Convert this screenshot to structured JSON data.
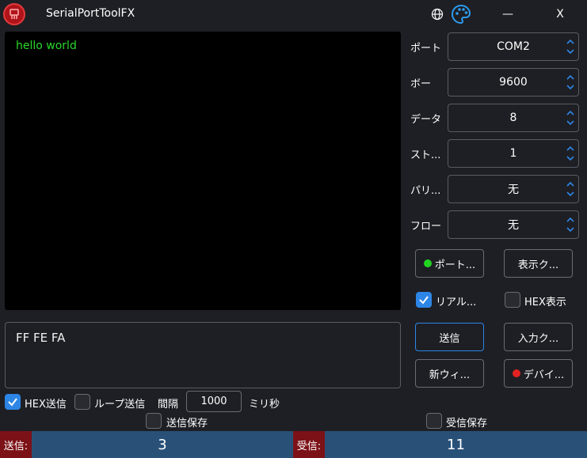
{
  "window": {
    "title": "SerialPortToolFX",
    "minimize_label": "—",
    "close_label": "X"
  },
  "receive": {
    "text": "hello world"
  },
  "send": {
    "text": "FF FE FA"
  },
  "settings": [
    {
      "label": "ポート",
      "value": "COM2"
    },
    {
      "label": "ボー",
      "value": "9600"
    },
    {
      "label": "データ",
      "value": "8"
    },
    {
      "label": "スト...",
      "value": "1"
    },
    {
      "label": "パリ...",
      "value": "无"
    },
    {
      "label": "フロー",
      "value": "无"
    }
  ],
  "buttons": {
    "port": "ポート...",
    "display_clear": "表示ク...",
    "send": "送信",
    "input_clear": "入力ク...",
    "new_window": "新ウィ...",
    "device": "デバイ..."
  },
  "checkboxes": {
    "realtime": {
      "label": "リアル...",
      "checked": true
    },
    "hex_display": {
      "label": "HEX表示",
      "checked": false
    },
    "hex_send": {
      "label": "HEX送信",
      "checked": true
    },
    "loop_send": {
      "label": "ループ送信",
      "checked": false
    },
    "send_save": {
      "label": "送信保存",
      "checked": false
    },
    "recv_save": {
      "label": "受信保存",
      "checked": false
    }
  },
  "interval": {
    "label": "間隔",
    "value": "1000",
    "unit": "ミリ秒"
  },
  "status": {
    "send_label": "送信:",
    "send_count": "3",
    "recv_label": "受信:",
    "recv_count": "11"
  },
  "colors": {
    "accent": "#2d86e6",
    "port_dot": "#22d322",
    "device_dot": "#e52222",
    "receive_text": "#2ad82a",
    "status_bar": "#295178",
    "status_tag": "#7c1217"
  }
}
